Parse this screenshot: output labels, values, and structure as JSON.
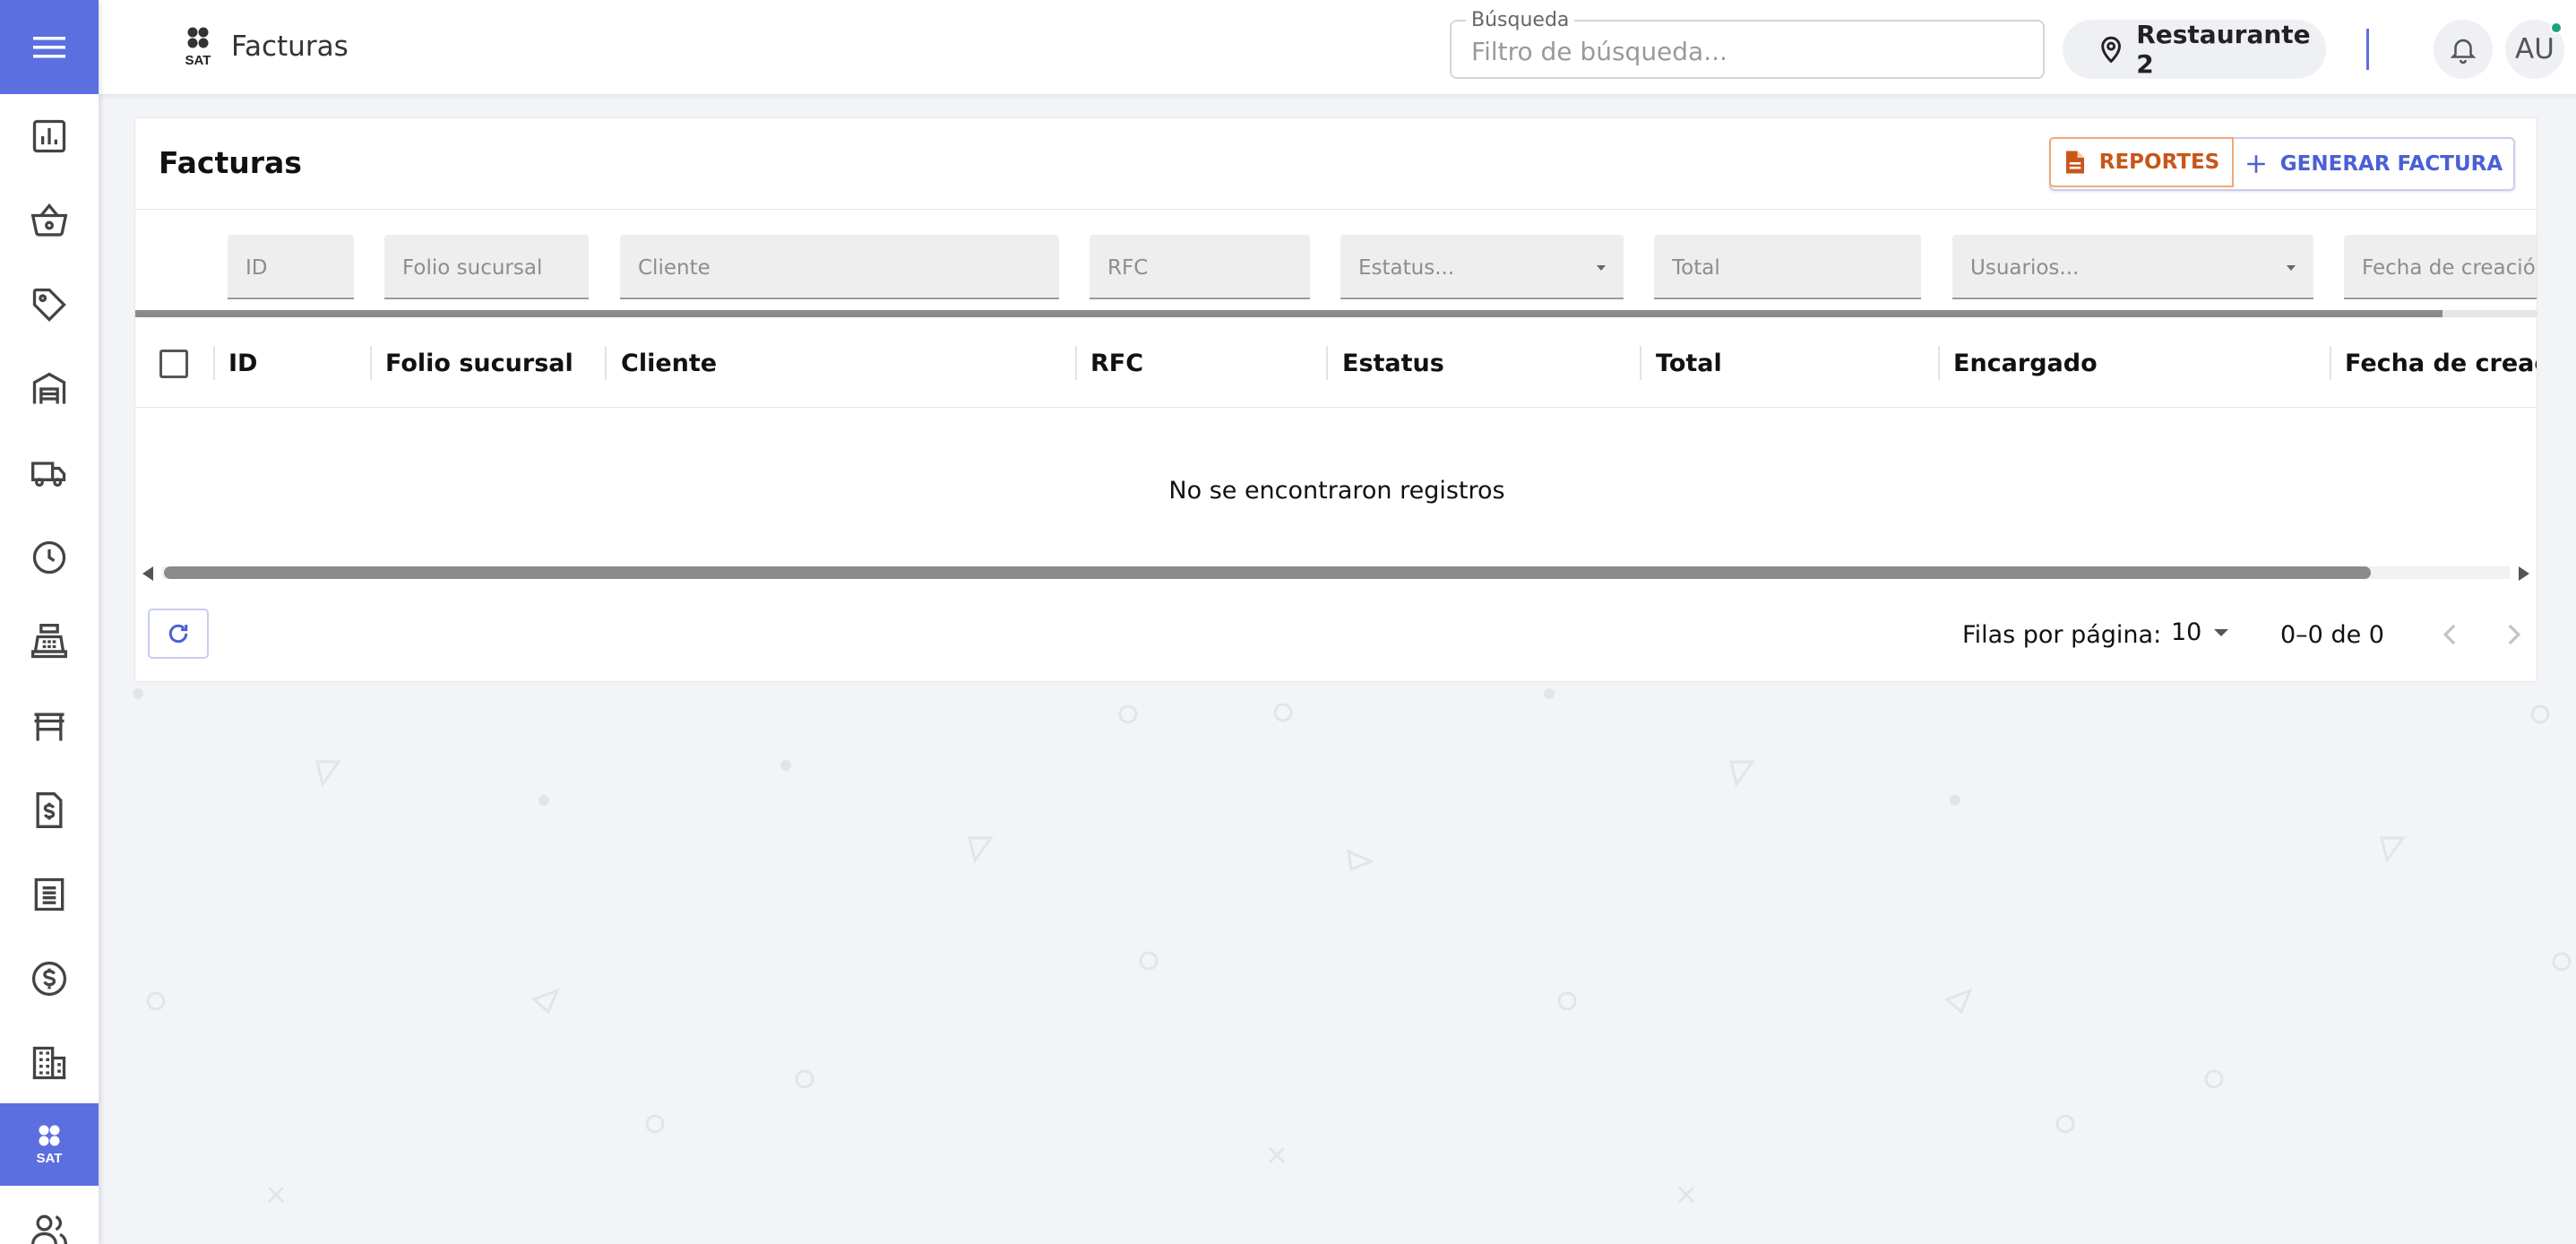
{
  "app": {
    "title": "Facturas",
    "logo_text": "SAT"
  },
  "topbar": {
    "search_label": "Búsqueda",
    "search_placeholder": "Filtro de búsqueda...",
    "search_value": "",
    "branch_label": "Restaurante 2",
    "avatar_initials": "AU"
  },
  "sidebar": {
    "items": [
      {
        "icon": "bar-chart-icon"
      },
      {
        "icon": "basket-icon"
      },
      {
        "icon": "tag-icon"
      },
      {
        "icon": "warehouse-icon"
      },
      {
        "icon": "truck-icon"
      },
      {
        "icon": "clock-icon"
      },
      {
        "icon": "cash-register-icon"
      },
      {
        "icon": "table-furniture-icon"
      },
      {
        "icon": "invoice-dollar-icon"
      },
      {
        "icon": "receipt-icon"
      },
      {
        "icon": "dollar-circle-icon"
      },
      {
        "icon": "building-icon"
      },
      {
        "icon": "sat-logo-icon",
        "active": true,
        "label": "SAT"
      },
      {
        "icon": "users-icon"
      }
    ]
  },
  "card": {
    "title": "Facturas",
    "reportes_label": "REPORTES",
    "generar_label": "GENERAR FACTURA"
  },
  "filters": {
    "id": "ID",
    "folio": "Folio sucursal",
    "cliente": "Cliente",
    "rfc": "RFC",
    "estatus": "Estatus...",
    "total": "Total",
    "usuarios": "Usuarios...",
    "fecha": "Fecha de creación"
  },
  "table": {
    "columns": [
      "ID",
      "Folio sucursal",
      "Cliente",
      "RFC",
      "Estatus",
      "Total",
      "Encargado",
      "Fecha de creació"
    ],
    "empty_message": "No se encontraron registros",
    "loading_progress": 0.96,
    "scroll_fraction": 0.94
  },
  "pagination": {
    "rows_label": "Filas por página:",
    "rows_value": "10",
    "range_label": "0–0 de 0"
  },
  "colors": {
    "accent": "#5b6fe0",
    "reportes": "#c8561a",
    "generar": "#4b5fd6",
    "notify_dot": "#1aa37a"
  }
}
